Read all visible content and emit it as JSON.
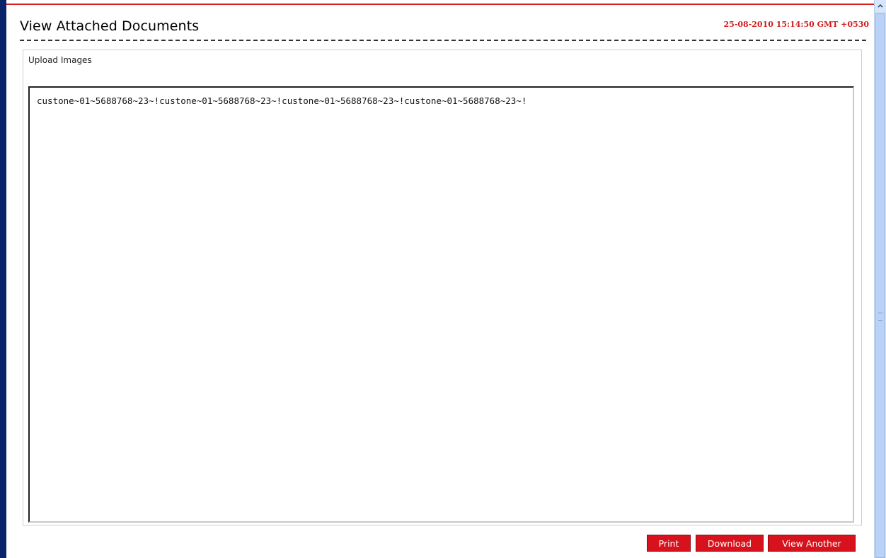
{
  "header": {
    "title": "View Attached Documents",
    "timestamp": "25-08-2010 15:14:50 GMT +0530"
  },
  "panel": {
    "label": "Upload Images",
    "document_text": "custone~01~5688768~23~!custone~01~5688768~23~!custone~01~5688768~23~!custone~01~5688768~23~!"
  },
  "buttons": {
    "print": "Print",
    "download": "Download",
    "view_another": "View Another"
  },
  "colors": {
    "accent": "#d8121c",
    "timestamp": "#d31c1c",
    "left_edge": "#0a246a"
  },
  "icons": {
    "scroll_up": "chevron-up-icon"
  }
}
